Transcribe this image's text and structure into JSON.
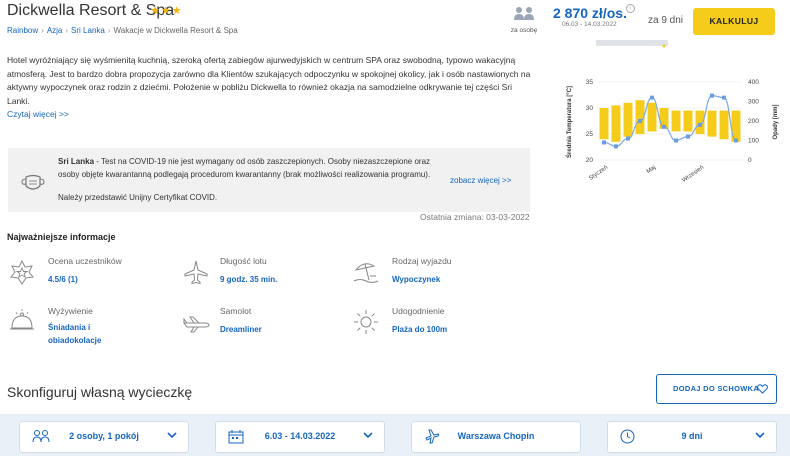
{
  "header": {
    "title": "Dickwella Resort & Spa",
    "stars": "★★★",
    "breadcrumbs": [
      "Rainbow",
      "Azja",
      "Sri Lanka",
      "Wakacje w Dickwella Resort & Spa"
    ],
    "persons_label": "za osobę",
    "price": "2 870 zł/os.",
    "price_dates": "06.03 - 14.03.2022",
    "days": "za 9 dni",
    "calc_button": "KALKULUJ"
  },
  "description": {
    "text": "Hotel wyróżniający się wyśmienitą kuchnią, szeroką ofertą zabiegów ajurwedyjskich w centrum SPA oraz swobodną, typowo wakacyjną atmosferą. Jest to bardzo dobra propozycja zarówno dla Klientów szukających odpoczynku w spokojnej okolicy, jak i osób nastawionych na aktywny wypoczynek oraz rodzin z dziećmi. Położenie w pobliżu Dickwella to również okazja na samodzielne odkrywanie tej części Sri Lanki.",
    "read_more": "Czytaj więcej >>"
  },
  "covid": {
    "country": "Sri Lanka",
    "text": " - Test na COVID-19 nie jest wymagany od osób zaszczepionych. Osoby niezaszczepione oraz osoby objęte kwarantanną podlegają procedurom kwarantanny (brak możliwości realizowania programu).",
    "note": "Należy przedstawić Unijny Certyfikat COVID.",
    "more": "zobacz więcej >>",
    "updated": "Ostatnia zmiana: 03-03-2022"
  },
  "key_info": {
    "heading": "Najważniejsze informacje",
    "items": [
      {
        "label": "Ocena uczestników",
        "value": "4.5/6 (1)",
        "icon": "star-badge-icon"
      },
      {
        "label": "Długość lotu",
        "value": "9 godz. 35 min.",
        "icon": "plane-icon"
      },
      {
        "label": "Rodzaj wyjazdu",
        "value": "Wypoczynek",
        "icon": "beach-umbrella-icon"
      },
      {
        "label": "Wyżywienie",
        "value": "Śniadania i obiadokolacje",
        "icon": "cloche-icon"
      },
      {
        "label": "Samolot",
        "value": "Dreamliner",
        "icon": "airliner-icon"
      },
      {
        "label": "Udogodnienie",
        "value": "Plaża do 100m",
        "icon": "sun-icon"
      }
    ]
  },
  "configure": {
    "title": "Skonfiguruj własną wycieczkę",
    "add_button": "DODAJ DO SCHOWKA",
    "selectors": [
      {
        "value": "2 osoby, 1 pokój",
        "icon": "people-icon"
      },
      {
        "value": "6.03 - 14.03.2022",
        "icon": "calendar-icon"
      },
      {
        "value": "Warszawa Chopin",
        "icon": "plane-icon"
      },
      {
        "value": "9 dni",
        "icon": "clock-icon"
      }
    ]
  },
  "chart_data": {
    "type": "bar+line",
    "title": "",
    "ylabel_left": "Średnia Temperatura [°C]",
    "ylabel_right": "Opady [mm]",
    "x_tick_labels": [
      "Styczeń",
      "Maj",
      "Wrzesień"
    ],
    "temp_ylim": [
      20,
      35
    ],
    "temp_yticks": [
      20,
      25,
      30,
      35
    ],
    "precip_ylim": [
      0,
      400
    ],
    "precip_yticks": [
      0,
      100,
      200,
      300,
      400
    ],
    "months": 12,
    "temperature_bars": [
      {
        "low": 24,
        "high": 30
      },
      {
        "low": 23.5,
        "high": 30.5
      },
      {
        "low": 24.5,
        "high": 31
      },
      {
        "low": 25,
        "high": 31.5
      },
      {
        "low": 25.5,
        "high": 31
      },
      {
        "low": 26,
        "high": 30
      },
      {
        "low": 25.5,
        "high": 29.5
      },
      {
        "low": 25.5,
        "high": 29.5
      },
      {
        "low": 25,
        "high": 29.5
      },
      {
        "low": 24.5,
        "high": 29.5
      },
      {
        "low": 24,
        "high": 29.5
      },
      {
        "low": 23.5,
        "high": 29.5
      }
    ],
    "precipitation": [
      90,
      70,
      110,
      200,
      320,
      170,
      100,
      120,
      180,
      330,
      320,
      100
    ],
    "colors": {
      "bars": "#f5cc1a",
      "line": "#7aa9e6",
      "markers": "#6a9de0"
    }
  }
}
